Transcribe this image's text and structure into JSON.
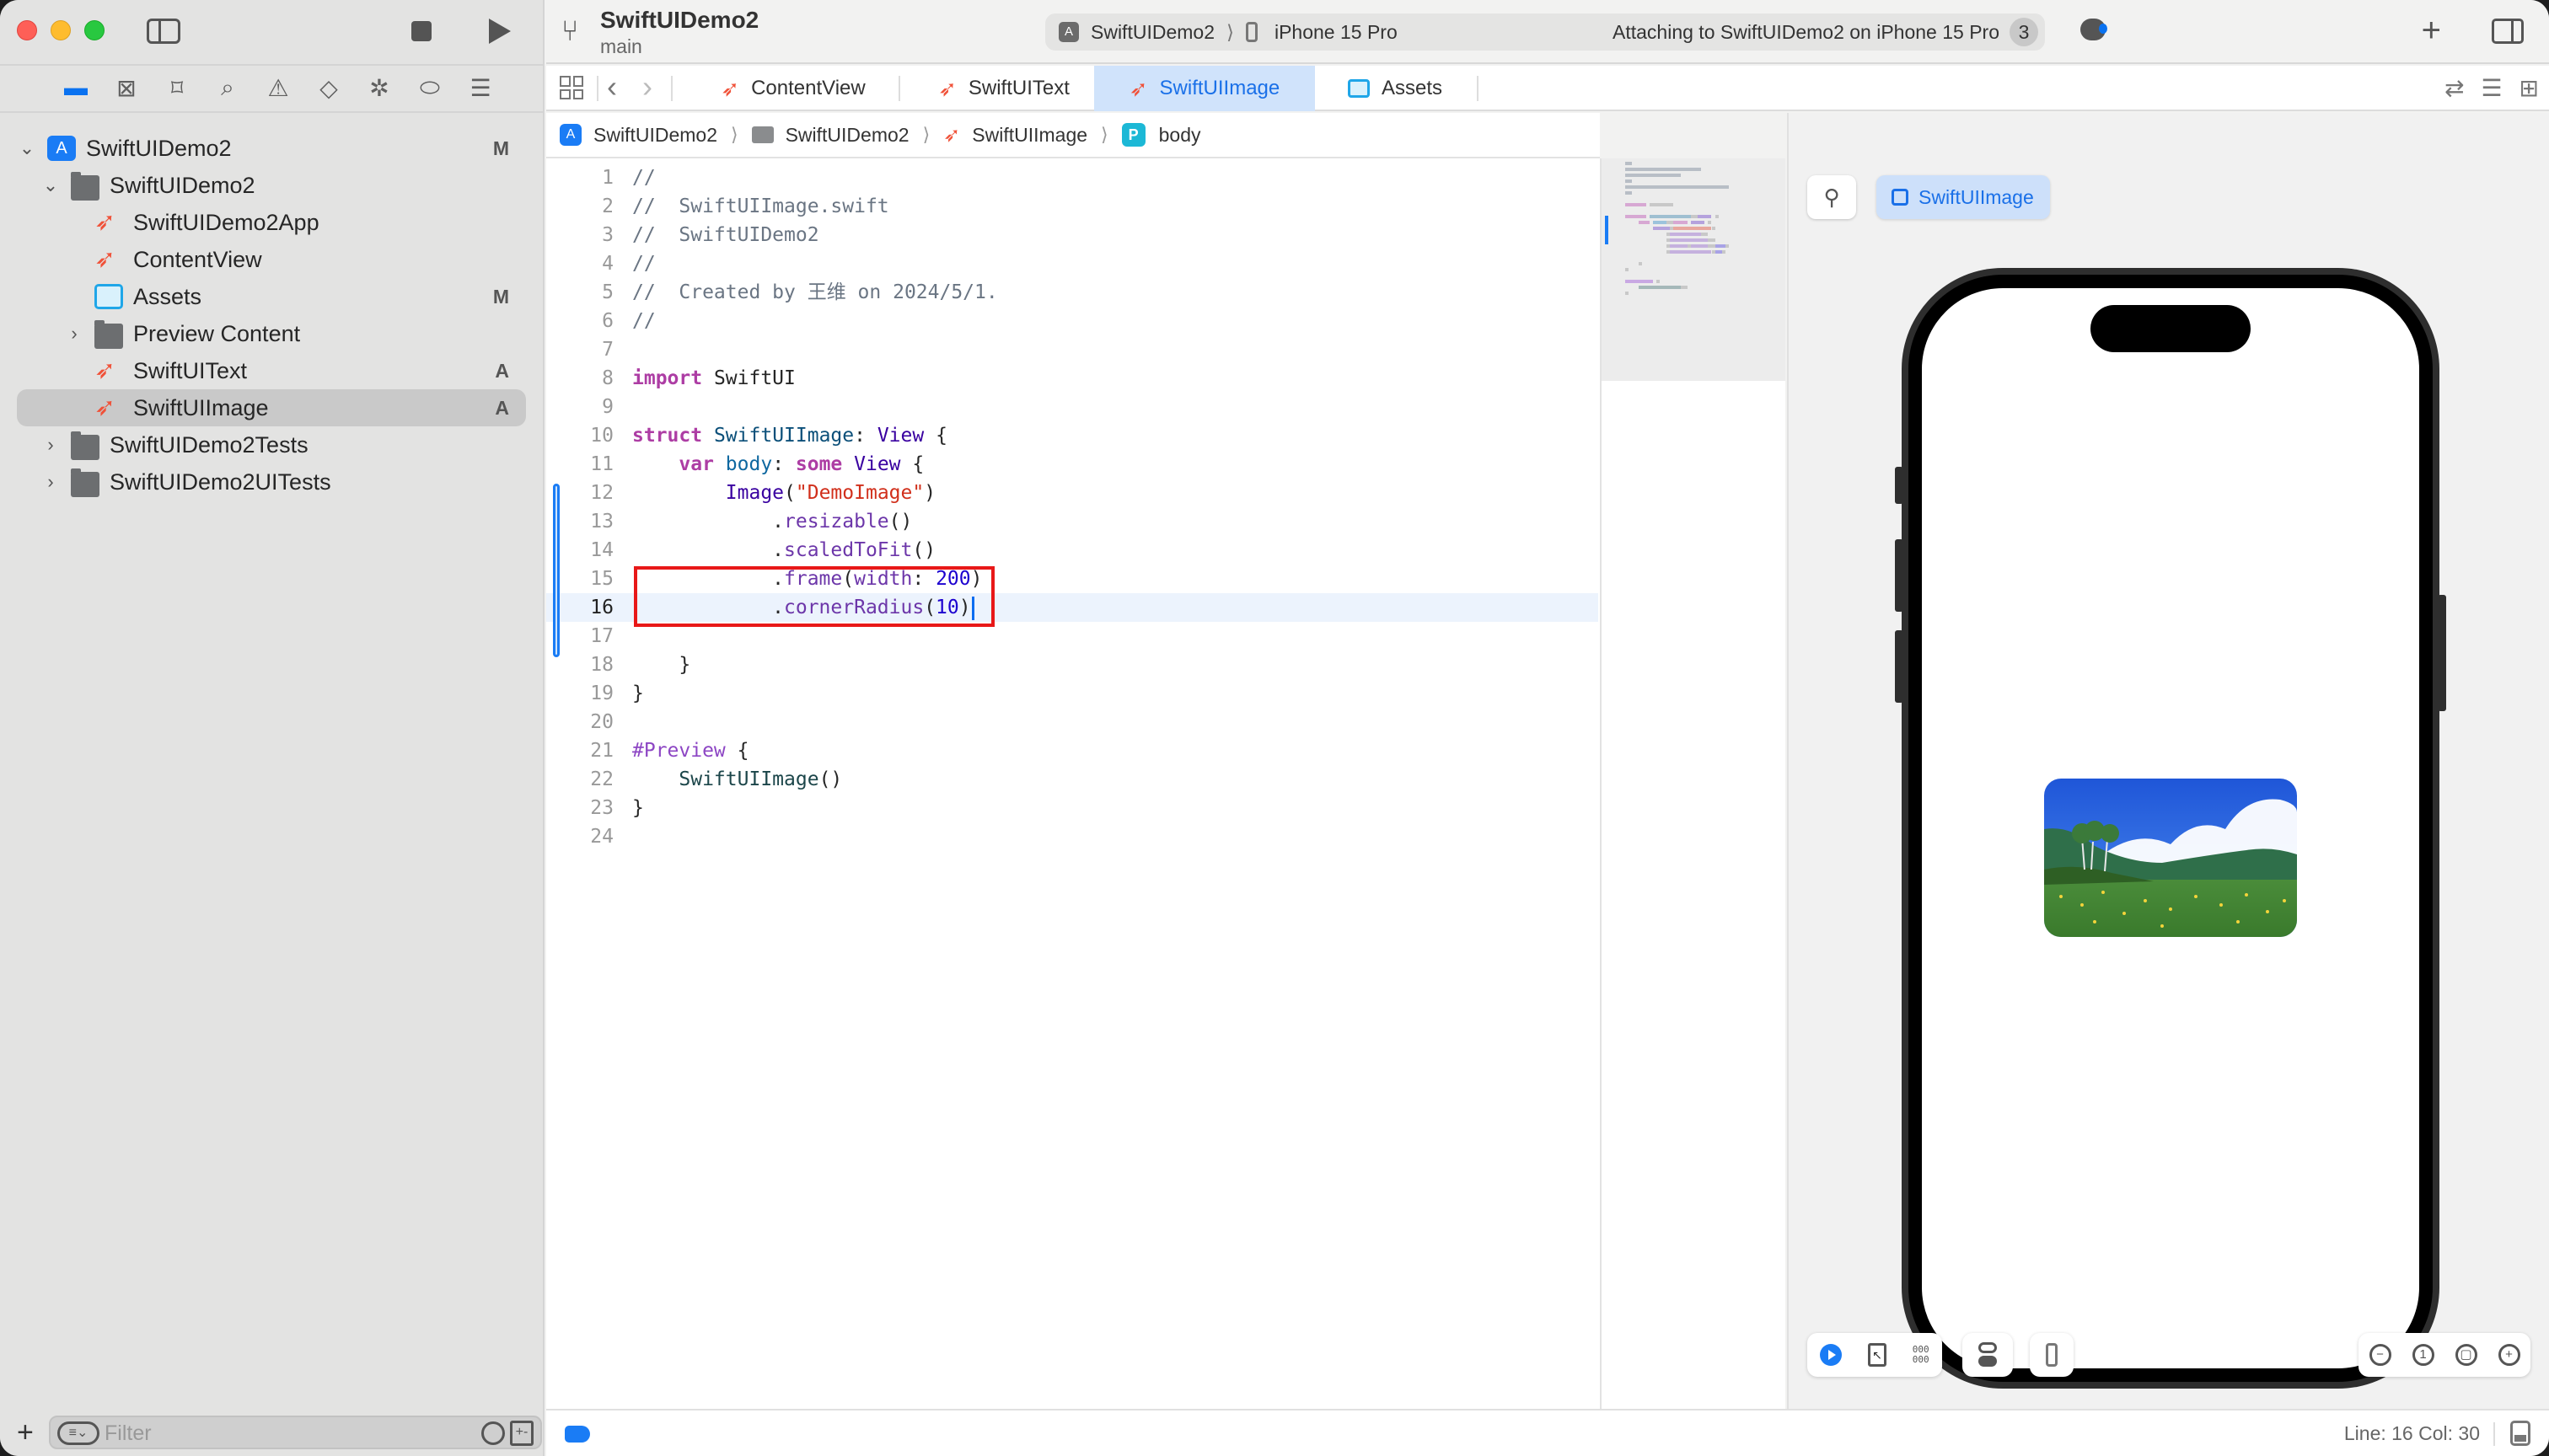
{
  "window": {
    "traffic_lights": [
      "close",
      "minimize",
      "zoom"
    ]
  },
  "toolbar": {
    "project_title": "SwiftUIDemo2",
    "branch": "main",
    "scheme": "SwiftUIDemo2",
    "destination": "iPhone 15 Pro",
    "status": "Attaching to SwiftUIDemo2 on iPhone 15 Pro",
    "status_count": "3",
    "add_label": "+"
  },
  "navigator_icons": [
    {
      "name": "project-navigator-icon",
      "glyph": "▬",
      "active": true
    },
    {
      "name": "source-control-navigator-icon",
      "glyph": "⊠"
    },
    {
      "name": "bookmark-navigator-icon",
      "glyph": "⌑"
    },
    {
      "name": "find-navigator-icon",
      "glyph": "⌕"
    },
    {
      "name": "issue-navigator-icon",
      "glyph": "⚠"
    },
    {
      "name": "test-navigator-icon",
      "glyph": "◇"
    },
    {
      "name": "debug-navigator-icon",
      "glyph": "✲"
    },
    {
      "name": "breakpoint-navigator-icon",
      "glyph": "⬭"
    },
    {
      "name": "report-navigator-icon",
      "glyph": "☰"
    }
  ],
  "tree": [
    {
      "label": "SwiftUIDemo2",
      "kind": "app",
      "indent": 0,
      "chevron": "⌄",
      "badge": "M"
    },
    {
      "label": "SwiftUIDemo2",
      "kind": "folder",
      "indent": 1,
      "chevron": "⌄",
      "badge": ""
    },
    {
      "label": "SwiftUIDemo2App",
      "kind": "swift",
      "indent": 2,
      "chevron": "",
      "badge": ""
    },
    {
      "label": "ContentView",
      "kind": "swift",
      "indent": 2,
      "chevron": "",
      "badge": ""
    },
    {
      "label": "Assets",
      "kind": "assets",
      "indent": 2,
      "chevron": "",
      "badge": "M"
    },
    {
      "label": "Preview Content",
      "kind": "folder",
      "indent": 2,
      "chevron": "›",
      "badge": ""
    },
    {
      "label": "SwiftUIText",
      "kind": "swift",
      "indent": 2,
      "chevron": "",
      "badge": "A"
    },
    {
      "label": "SwiftUIImage",
      "kind": "swift",
      "indent": 2,
      "chevron": "",
      "badge": "A",
      "selected": true
    },
    {
      "label": "SwiftUIDemo2Tests",
      "kind": "folder",
      "indent": 1,
      "chevron": "›",
      "badge": ""
    },
    {
      "label": "SwiftUIDemo2UITests",
      "kind": "folder",
      "indent": 1,
      "chevron": "›",
      "badge": ""
    }
  ],
  "filter": {
    "placeholder": "Filter",
    "value": ""
  },
  "tabs": [
    {
      "label": "ContentView",
      "kind": "swift"
    },
    {
      "label": "SwiftUIText",
      "kind": "swift"
    },
    {
      "label": "SwiftUIImage",
      "kind": "swift",
      "active": true
    },
    {
      "label": "Assets",
      "kind": "assets"
    }
  ],
  "breadcrumb": [
    {
      "label": "SwiftUIDemo2",
      "kind": "app"
    },
    {
      "label": "SwiftUIDemo2",
      "kind": "folder"
    },
    {
      "label": "SwiftUIImage",
      "kind": "swift"
    },
    {
      "label": "body",
      "kind": "property",
      "badge": "P"
    }
  ],
  "editor": {
    "current_line": 16,
    "highlighted_lines": [
      15,
      16
    ],
    "lines": [
      [
        {
          "t": "//",
          "c": "comment"
        }
      ],
      [
        {
          "t": "//  SwiftUIImage.swift",
          "c": "comment"
        }
      ],
      [
        {
          "t": "//  SwiftUIDemo2",
          "c": "comment"
        }
      ],
      [
        {
          "t": "//",
          "c": "comment"
        }
      ],
      [
        {
          "t": "//  Created by 王维 on 2024/5/1.",
          "c": "comment"
        }
      ],
      [
        {
          "t": "//",
          "c": "comment"
        }
      ],
      [],
      [
        {
          "t": "import",
          "c": "kw"
        },
        {
          "t": " SwiftUI",
          "c": "plain"
        }
      ],
      [],
      [
        {
          "t": "struct",
          "c": "kw"
        },
        {
          "t": " ",
          "c": "plain"
        },
        {
          "t": "SwiftUIImage",
          "c": "type"
        },
        {
          "t": ": ",
          "c": "plain"
        },
        {
          "t": "View",
          "c": "typeref"
        },
        {
          "t": " {",
          "c": "plain"
        }
      ],
      [
        {
          "t": "    ",
          "c": "plain"
        },
        {
          "t": "var",
          "c": "kw"
        },
        {
          "t": " ",
          "c": "plain"
        },
        {
          "t": "body",
          "c": "prop"
        },
        {
          "t": ": ",
          "c": "plain"
        },
        {
          "t": "some",
          "c": "kw"
        },
        {
          "t": " ",
          "c": "plain"
        },
        {
          "t": "View",
          "c": "typeref"
        },
        {
          "t": " {",
          "c": "plain"
        }
      ],
      [
        {
          "t": "        ",
          "c": "plain"
        },
        {
          "t": "Image",
          "c": "typeref"
        },
        {
          "t": "(",
          "c": "plain"
        },
        {
          "t": "\"DemoImage\"",
          "c": "str"
        },
        {
          "t": ")",
          "c": "plain"
        }
      ],
      [
        {
          "t": "            .",
          "c": "plain"
        },
        {
          "t": "resizable",
          "c": "func"
        },
        {
          "t": "()",
          "c": "plain"
        }
      ],
      [
        {
          "t": "            .",
          "c": "plain"
        },
        {
          "t": "scaledToFit",
          "c": "func"
        },
        {
          "t": "()",
          "c": "plain"
        }
      ],
      [
        {
          "t": "            .",
          "c": "plain"
        },
        {
          "t": "frame",
          "c": "func"
        },
        {
          "t": "(",
          "c": "plain"
        },
        {
          "t": "width",
          "c": "func"
        },
        {
          "t": ": ",
          "c": "plain"
        },
        {
          "t": "200",
          "c": "num"
        },
        {
          "t": ")",
          "c": "plain"
        }
      ],
      [
        {
          "t": "            .",
          "c": "plain"
        },
        {
          "t": "cornerRadius",
          "c": "func"
        },
        {
          "t": "(",
          "c": "plain"
        },
        {
          "t": "10",
          "c": "num"
        },
        {
          "t": ")",
          "c": "plain"
        }
      ],
      [],
      [
        {
          "t": "    }",
          "c": "plain"
        }
      ],
      [
        {
          "t": "}",
          "c": "plain"
        }
      ],
      [],
      [
        {
          "t": "#Preview",
          "c": "preview"
        },
        {
          "t": " {",
          "c": "plain"
        }
      ],
      [
        {
          "t": "    ",
          "c": "plain"
        },
        {
          "t": "SwiftUIImage",
          "c": "call"
        },
        {
          "t": "()",
          "c": "plain"
        }
      ],
      [
        {
          "t": "}",
          "c": "plain"
        }
      ],
      []
    ]
  },
  "preview": {
    "chip_label": "SwiftUIImage",
    "device": "iPhone 15 Pro",
    "image_name": "DemoImage",
    "image_description": "meadow with yellow flowers, trees, mountains and clouds",
    "mode": "live",
    "zoom_controls": [
      "zoom-out",
      "actual-size",
      "zoom-to-fit",
      "zoom-in"
    ]
  },
  "statusbar": {
    "line_col": "Line: 16  Col: 30"
  },
  "colors": {
    "accent": "#1a7cf5",
    "swift_orange": "#f05138",
    "highlight_red": "#e81818",
    "active_tab_bg": "#d0e3fb"
  }
}
